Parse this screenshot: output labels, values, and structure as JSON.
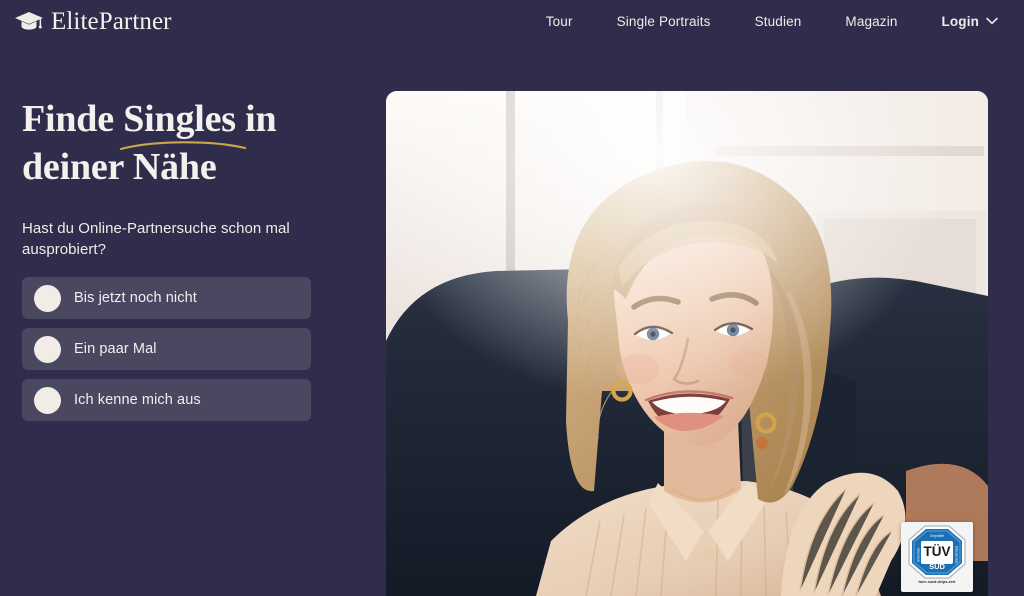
{
  "header": {
    "brand": {
      "name": "ElitePartner",
      "icon": "graduation-cap-icon"
    },
    "nav": [
      {
        "label": "Tour"
      },
      {
        "label": "Single Portraits"
      },
      {
        "label": "Studien"
      },
      {
        "label": "Magazin"
      }
    ],
    "login": {
      "label": "Login",
      "icon": "chevron-down-icon"
    }
  },
  "hero": {
    "headline_part1": "Finde ",
    "headline_highlight": "Singles",
    "headline_part2": " in deiner Nähe",
    "highlight_underline_color": "#c9a84c",
    "question": "Hast du Online-Partnersuche schon mal ausprobiert?",
    "options": [
      {
        "label": "Bis jetzt noch nicht"
      },
      {
        "label": "Ein paar Mal"
      },
      {
        "label": "Ich kenne mich aus"
      }
    ]
  },
  "photo": {
    "alt": "Lächelnde blonde Frau auf dunklem Sofa"
  },
  "badge": {
    "title": "TÜV",
    "subtitle": "SÜD",
    "top_text": "Geprüfte",
    "left_text": "Sicherheit",
    "right_text": "Datenschutz",
    "url": "tuev-sued.de/ps-zert"
  },
  "colors": {
    "background": "#2f2d4b",
    "option_background": "#4a4761",
    "text": "#f2eee9",
    "accent_gold": "#c9a84c",
    "radio_fill": "#f2ece6",
    "badge_blue": "#1b6fb5"
  }
}
